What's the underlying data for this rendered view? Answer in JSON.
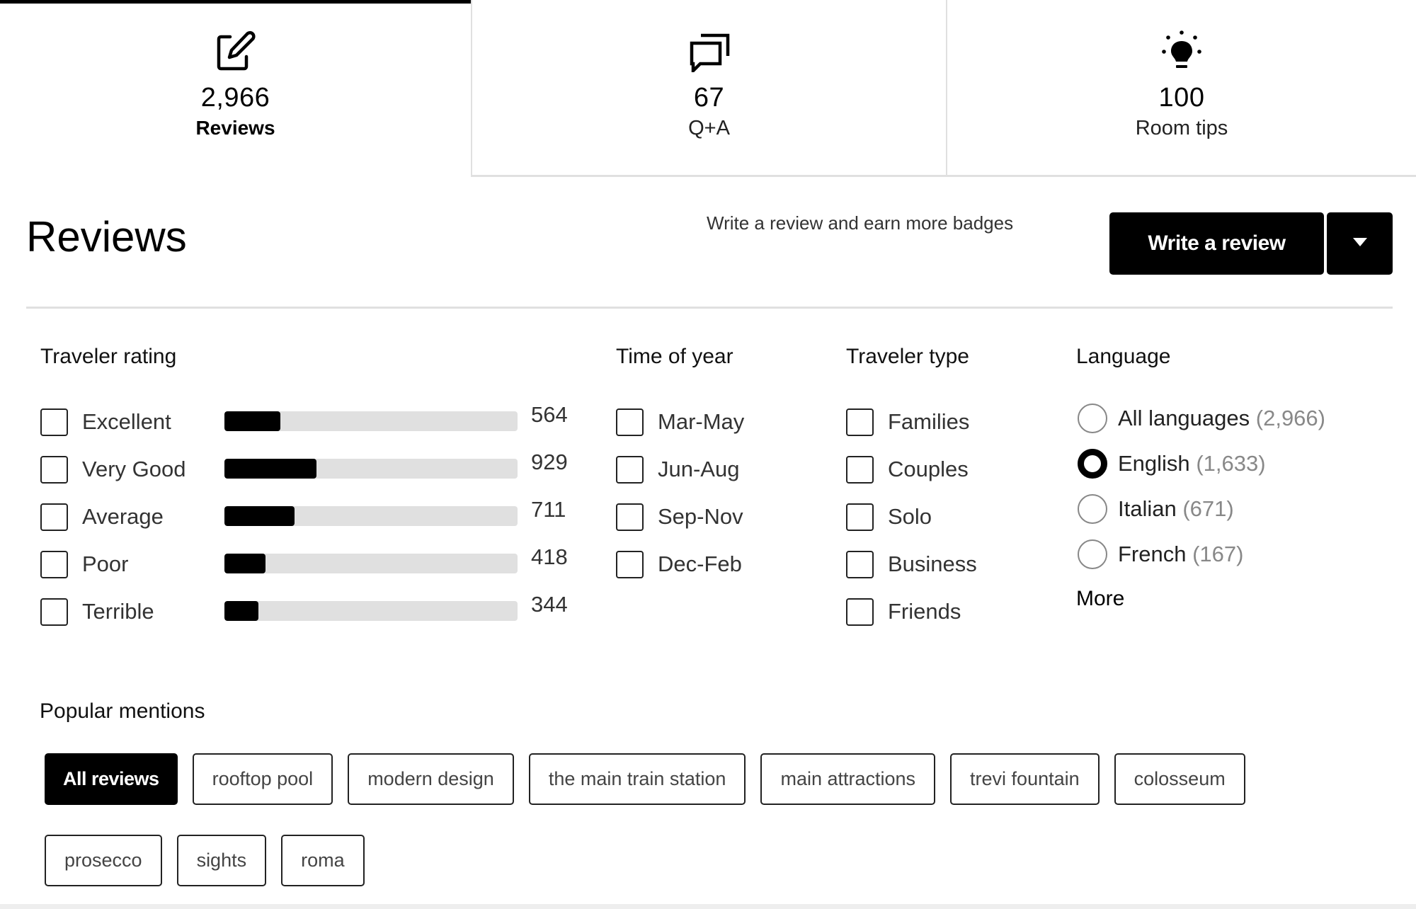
{
  "tabs": [
    {
      "count": "2,966",
      "label": "Reviews",
      "icon": "edit-pencil-icon",
      "active": true
    },
    {
      "count": "67",
      "label": "Q+A",
      "icon": "chat-bubbles-icon",
      "active": false
    },
    {
      "count": "100",
      "label": "Room tips",
      "icon": "lightbulb-icon",
      "active": false
    }
  ],
  "header": {
    "title": "Reviews",
    "badge_prompt": "Write a review and earn more badges",
    "write_button": "Write a review",
    "dropdown_icon": "caret-down-icon"
  },
  "filters": {
    "traveler_rating": {
      "title": "Traveler rating",
      "total": 2966,
      "items": [
        {
          "label": "Excellent",
          "count": "564",
          "value": 564,
          "checked": false
        },
        {
          "label": "Very Good",
          "count": "929",
          "value": 929,
          "checked": false
        },
        {
          "label": "Average",
          "count": "711",
          "value": 711,
          "checked": false
        },
        {
          "label": "Poor",
          "count": "418",
          "value": 418,
          "checked": false
        },
        {
          "label": "Terrible",
          "count": "344",
          "value": 344,
          "checked": false
        }
      ]
    },
    "time_of_year": {
      "title": "Time of year",
      "items": [
        {
          "label": "Mar-May",
          "checked": false
        },
        {
          "label": "Jun-Aug",
          "checked": false
        },
        {
          "label": "Sep-Nov",
          "checked": false
        },
        {
          "label": "Dec-Feb",
          "checked": false
        }
      ]
    },
    "traveler_type": {
      "title": "Traveler type",
      "items": [
        {
          "label": "Families",
          "checked": false
        },
        {
          "label": "Couples",
          "checked": false
        },
        {
          "label": "Solo",
          "checked": false
        },
        {
          "label": "Business",
          "checked": false
        },
        {
          "label": "Friends",
          "checked": false
        }
      ]
    },
    "language": {
      "title": "Language",
      "items": [
        {
          "label": "All languages",
          "count": "(2,966)",
          "selected": false
        },
        {
          "label": "English",
          "count": "(1,633)",
          "selected": true
        },
        {
          "label": "Italian",
          "count": "(671)",
          "selected": false
        },
        {
          "label": "French",
          "count": "(167)",
          "selected": false
        }
      ],
      "more_label": "More"
    }
  },
  "popular_mentions": {
    "title": "Popular mentions",
    "chips": [
      {
        "label": "All reviews",
        "active": true
      },
      {
        "label": "rooftop pool",
        "active": false
      },
      {
        "label": "modern design",
        "active": false
      },
      {
        "label": "the main train station",
        "active": false
      },
      {
        "label": "main attractions",
        "active": false
      },
      {
        "label": "trevi fountain",
        "active": false
      },
      {
        "label": "colosseum",
        "active": false
      },
      {
        "label": "prosecco",
        "active": false
      },
      {
        "label": "sights",
        "active": false
      },
      {
        "label": "roma",
        "active": false
      }
    ]
  }
}
